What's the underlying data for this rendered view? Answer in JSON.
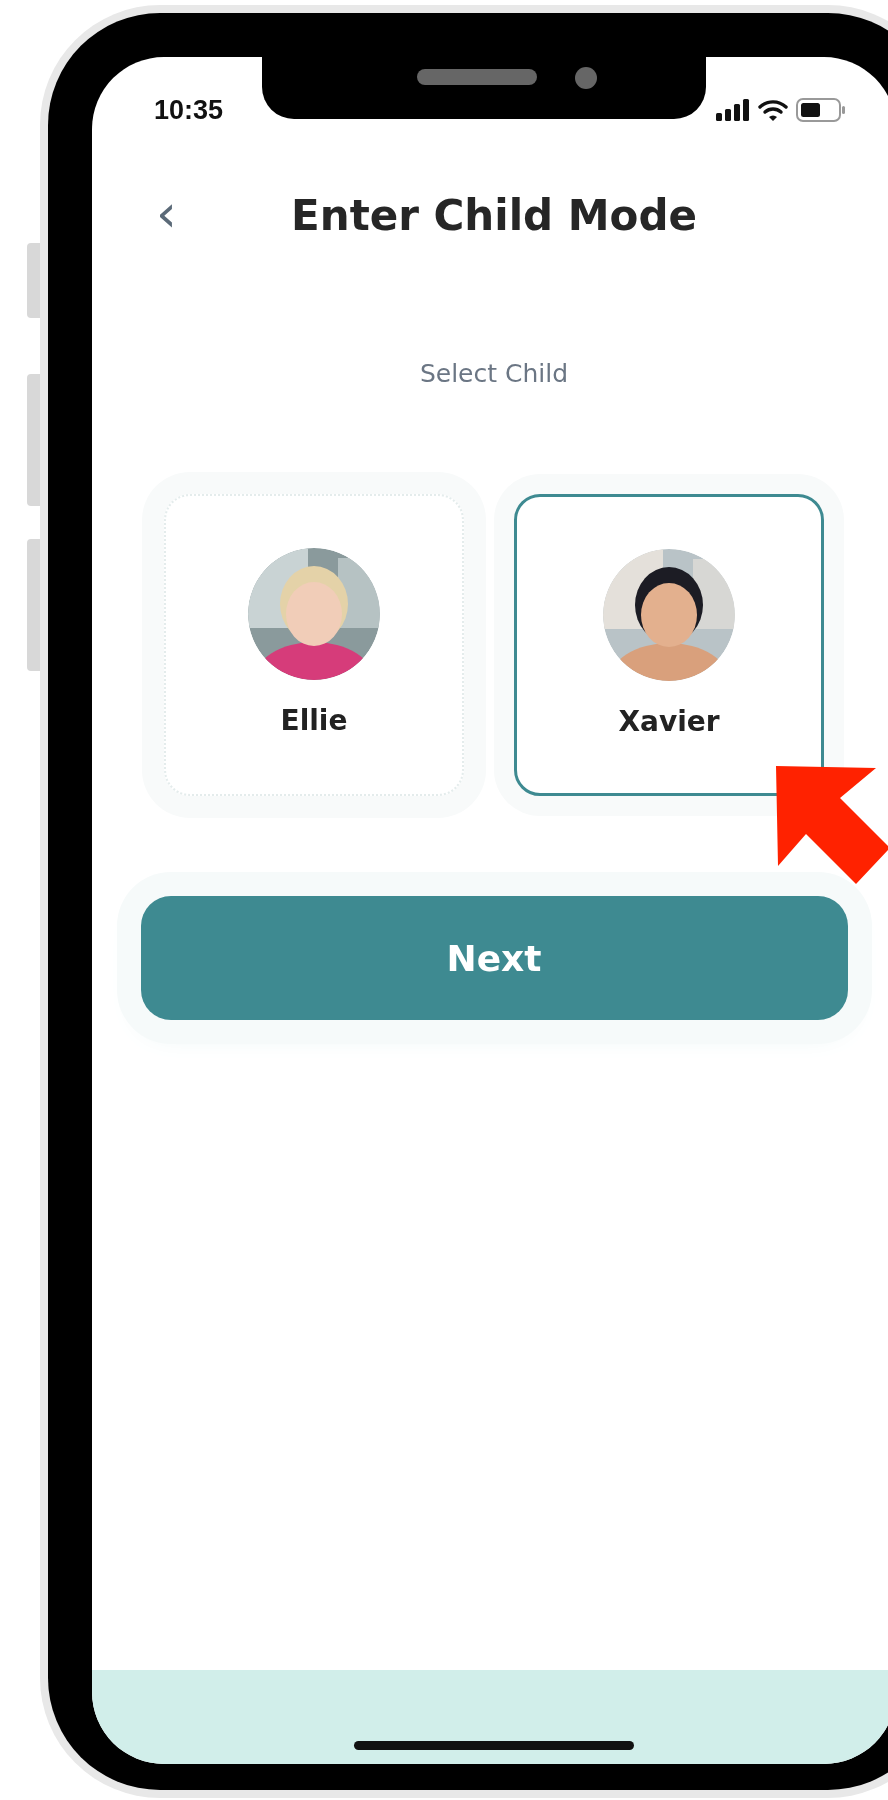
{
  "status_bar": {
    "time": "10:35"
  },
  "header": {
    "back": "‹",
    "title": "Enter Child Mode"
  },
  "prompt": "Select Child",
  "children": [
    {
      "name": "Ellie",
      "selected": false
    },
    {
      "name": "Xavier",
      "selected": true
    }
  ],
  "next_button": {
    "label": "Next"
  }
}
